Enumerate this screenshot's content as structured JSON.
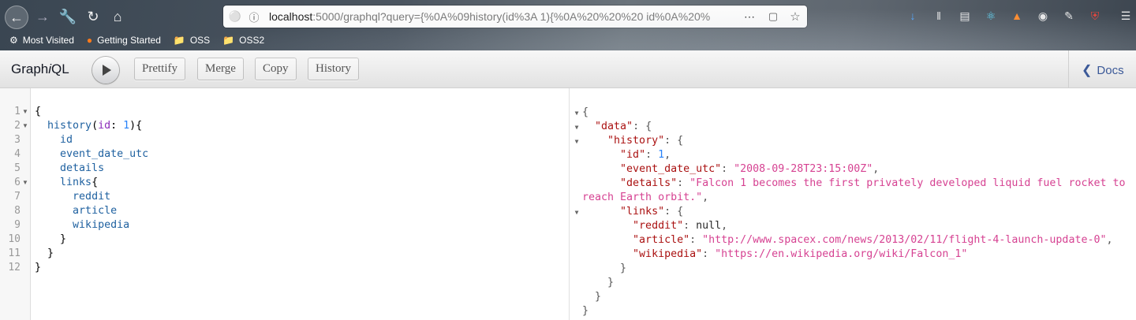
{
  "browser": {
    "url_host": "localhost",
    "url_rest": ":5000/graphql?query={%0A%09history(id%3A 1){%0A%20%20%20 id%0A%20%",
    "bookmarks": [
      "Most Visited",
      "Getting Started",
      "OSS",
      "OSS2"
    ]
  },
  "toolbar": {
    "title_prefix": "Graph",
    "title_italic": "i",
    "title_suffix": "QL",
    "buttons": [
      "Prettify",
      "Merge",
      "Copy",
      "History"
    ],
    "docs_label": "Docs"
  },
  "query": {
    "line_numbers": [
      "1",
      "2",
      "3",
      "4",
      "5",
      "6",
      "7",
      "8",
      "9",
      "10",
      "11",
      "12"
    ],
    "lines": [
      "{",
      "  history(id: 1){",
      "    id",
      "    event_date_utc",
      "    details",
      "    links{",
      "      reddit",
      "      article",
      "      wikipedia",
      "    }",
      "  }",
      "}"
    ]
  },
  "result": {
    "data_key": "\"data\"",
    "history_key": "\"history\"",
    "id_key": "\"id\"",
    "id_value": "1",
    "date_key": "\"event_date_utc\"",
    "date_value": "\"2008-09-28T23:15:00Z\"",
    "details_key": "\"details\"",
    "details_value_line1": "\"Falcon 1 becomes the first privately developed liquid fuel rocket to",
    "details_value_line2": "reach Earth orbit.\"",
    "links_key": "\"links\"",
    "reddit_key": "\"reddit\"",
    "reddit_value": "null",
    "article_key": "\"article\"",
    "article_value": "\"http://www.spacex.com/news/2013/02/11/flight-4-launch-update-0\"",
    "wikipedia_key": "\"wikipedia\"",
    "wikipedia_value": "\"https://en.wikipedia.org/wiki/Falcon_1\""
  }
}
